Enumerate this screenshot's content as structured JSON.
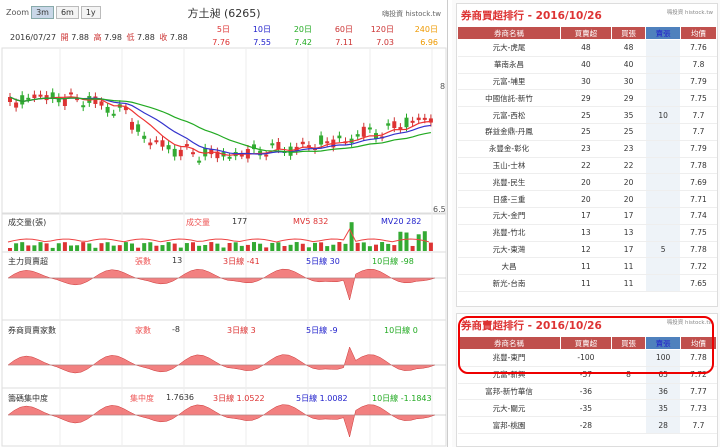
{
  "zoom": {
    "label": "Zoom",
    "buttons": [
      "3m",
      "6m",
      "1y"
    ],
    "active": "3m"
  },
  "stock": {
    "title": "方土昶 (6265)",
    "brand": "嗨投資 histock.tw"
  },
  "ohlc": {
    "date": "2016/07/27",
    "open_label": "開",
    "open": "7.88",
    "high_label": "高",
    "high": "7.98",
    "low_label": "低",
    "low": "7.88",
    "close_label": "收",
    "close": "7.88"
  },
  "ma": [
    {
      "label": "5日",
      "value": "7.76"
    },
    {
      "label": "10日",
      "value": "7.55"
    },
    {
      "label": "20日",
      "value": "7.42"
    },
    {
      "label": "60日",
      "value": "7.11"
    },
    {
      "label": "120日",
      "value": "7.03"
    },
    {
      "label": "240日",
      "value": "6.96"
    }
  ],
  "price_axis": {
    "top": "8",
    "bottom": "6.5"
  },
  "panels": {
    "volume": {
      "label": "成交量(張)",
      "v_label": "成交量",
      "v": "177",
      "mv5": "MV5 832",
      "mv20": "MV20 282"
    },
    "main": {
      "label": "主力買賣超",
      "units": "張數",
      "units_val": "13",
      "l3": "3日線 -41",
      "l5": "5日線 30",
      "l10": "10日線 -98"
    },
    "brokers": {
      "label": "券商買賣家數",
      "units": "家數",
      "units_val": "-8",
      "l3": "3日線 3",
      "l5": "5日線 -9",
      "l10": "10日線 0"
    },
    "conc": {
      "label": "籌碼集中度",
      "units": "集中度",
      "units_val": "1.7636",
      "l3": "3日線 1.0522",
      "l5": "5日線 1.0082",
      "l10": "10日線 -1.1843"
    }
  },
  "buy_rank": {
    "title": "券商買超排行 - 2016/10/26",
    "brand": "嗨投資 histock.tw",
    "headers": [
      "券商名稱",
      "買賣超",
      "買張",
      "賣張",
      "均價"
    ],
    "rows": [
      [
        "元大-虎尾",
        "48",
        "48",
        "",
        "7.76"
      ],
      [
        "華南永昌",
        "40",
        "40",
        "",
        "7.8"
      ],
      [
        "元富-埔里",
        "30",
        "30",
        "",
        "7.79"
      ],
      [
        "中國信託-新竹",
        "29",
        "29",
        "",
        "7.75"
      ],
      [
        "元富-西松",
        "25",
        "35",
        "10",
        "7.7"
      ],
      [
        "群益金鼎-丹鳳",
        "25",
        "25",
        "",
        "7.7"
      ],
      [
        "永豐金-彰化",
        "23",
        "23",
        "",
        "7.79"
      ],
      [
        "玉山-士林",
        "22",
        "22",
        "",
        "7.78"
      ],
      [
        "兆豐-民生",
        "20",
        "20",
        "",
        "7.69"
      ],
      [
        "日盛-三重",
        "20",
        "20",
        "",
        "7.71"
      ],
      [
        "元大-金門",
        "17",
        "17",
        "",
        "7.74"
      ],
      [
        "兆豐-竹北",
        "13",
        "13",
        "",
        "7.75"
      ],
      [
        "元大-東灣",
        "12",
        "17",
        "5",
        "7.78"
      ],
      [
        "大昌",
        "11",
        "11",
        "",
        "7.72"
      ],
      [
        "新光-台南",
        "11",
        "11",
        "",
        "7.65"
      ]
    ]
  },
  "sell_rank": {
    "title": "券商賣超排行 - 2016/10/26",
    "brand": "嗨投資 histock.tw",
    "headers": [
      "券商名稱",
      "買賣超",
      "買張",
      "賣張",
      "均價"
    ],
    "rows": [
      [
        "兆豐-東門",
        "-100",
        "",
        "100",
        "7.78"
      ],
      [
        "元富-新興",
        "-57",
        "8",
        "65",
        "7.72"
      ],
      [
        "富邦-新竹華信",
        "-36",
        "",
        "36",
        "7.77"
      ],
      [
        "元大-關元",
        "-35",
        "",
        "35",
        "7.73"
      ],
      [
        "富邦-桃園",
        "-28",
        "",
        "28",
        "7.7"
      ]
    ]
  }
}
